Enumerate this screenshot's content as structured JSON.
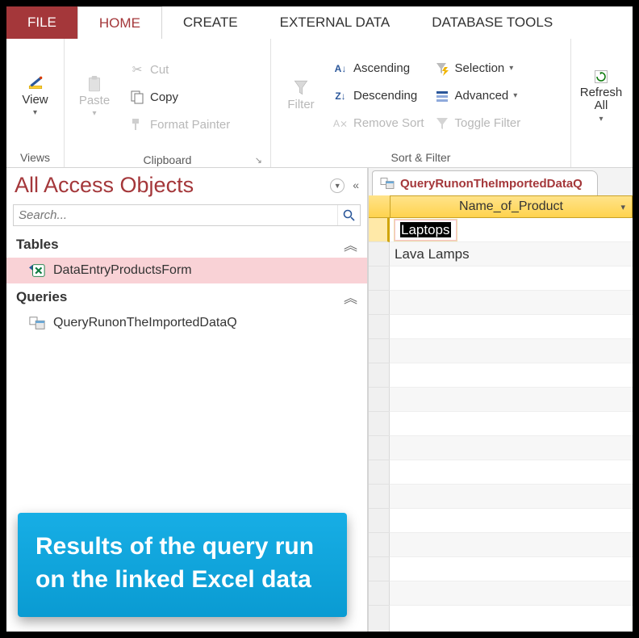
{
  "tabs": {
    "file": "FILE",
    "home": "HOME",
    "create": "CREATE",
    "external": "EXTERNAL DATA",
    "dbtools": "DATABASE TOOLS"
  },
  "ribbon": {
    "views": {
      "view": "View",
      "group": "Views"
    },
    "clipboard": {
      "paste": "Paste",
      "cut": "Cut",
      "copy": "Copy",
      "painter": "Format Painter",
      "group": "Clipboard"
    },
    "sortfilter": {
      "filter": "Filter",
      "asc": "Ascending",
      "desc": "Descending",
      "remove": "Remove Sort",
      "selection": "Selection",
      "advanced": "Advanced",
      "toggle": "Toggle Filter",
      "group": "Sort & Filter"
    },
    "records": {
      "refresh": "Refresh\nAll"
    }
  },
  "nav": {
    "title": "All Access Objects",
    "search_placeholder": "Search...",
    "tables_label": "Tables",
    "queries_label": "Queries",
    "table_item": "DataEntryProductsForm",
    "query_item": "QueryRunonTheImportedDataQ"
  },
  "callout": "Results of the query run on the linked Excel data",
  "sheet": {
    "tab": "QueryRunonTheImportedDataQ",
    "column": "Name_of_Product",
    "rows": [
      "Laptops",
      "Lava Lamps"
    ]
  }
}
